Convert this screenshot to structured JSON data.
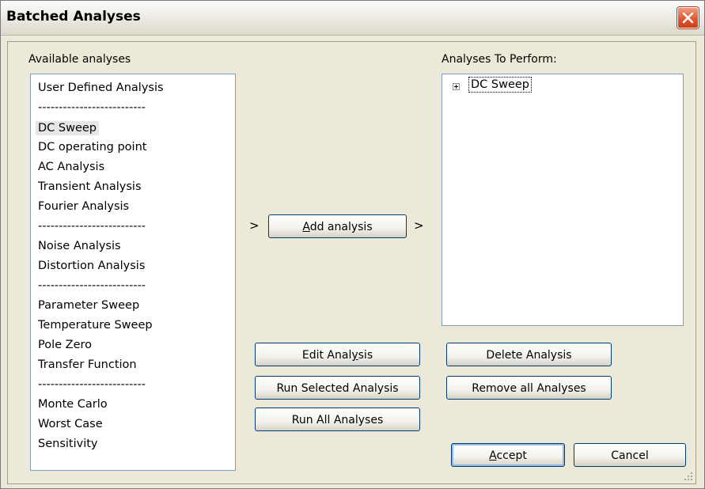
{
  "window": {
    "title": "Batched Analyses",
    "close_label": "X"
  },
  "available": {
    "label": "Available analyses",
    "items": [
      "User Defined Analysis",
      "--------------------------",
      "DC Sweep",
      "DC operating point",
      "AC Analysis",
      "Transient Analysis",
      "Fourier Analysis",
      "--------------------------",
      "Noise Analysis",
      "Distortion Analysis",
      "--------------------------",
      "Parameter Sweep",
      "Temperature Sweep",
      "Pole Zero",
      "Transfer Function",
      "--------------------------",
      "Monte Carlo",
      "Worst Case",
      "Sensitivity"
    ],
    "selected": "DC Sweep"
  },
  "perform": {
    "label": "Analyses To Perform:",
    "tree": [
      {
        "label": "DC Sweep",
        "expander": "+"
      }
    ]
  },
  "add": {
    "arrow_left": ">",
    "arrow_right": ">",
    "label_accel": "A",
    "label_rest": "dd analysis"
  },
  "buttons": {
    "edit_pre": "Edit Anal",
    "edit_accel": "y",
    "edit_post": "sis",
    "run_selected": "Run Selected Analysis",
    "run_all": "Run All Analyses",
    "delete": "Delete Analysis",
    "remove_all": "Remove all Analyses",
    "accept_accel": "A",
    "accept_rest": "ccept",
    "cancel": "Cancel"
  }
}
